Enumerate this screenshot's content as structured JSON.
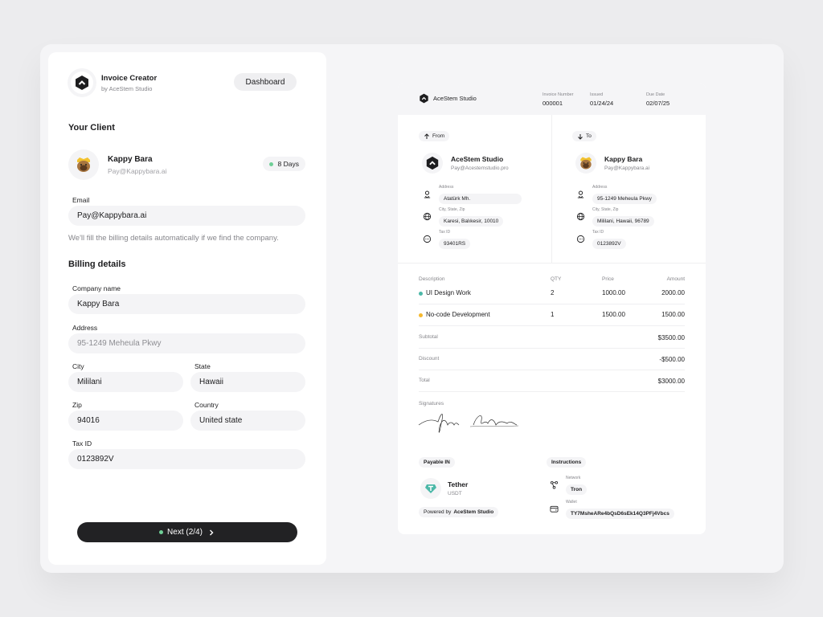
{
  "app": {
    "title": "Invoice Creator",
    "subtitle": "by AceStem Studio",
    "dashboard_label": "Dashboard"
  },
  "client": {
    "section_title": "Your Client",
    "name": "Kappy Bara",
    "email": "Pay@Kappybara.ai",
    "days_badge": "8 Days",
    "days_color": "#6fcf97"
  },
  "form": {
    "email_label": "Email",
    "email_value": "Pay@Kappybara.ai",
    "hint": "We'll fill the billing details automatically if we find the company.",
    "billing_title": "Billing details",
    "company_label": "Company name",
    "company_value": "Kappy Bara",
    "address_label": "Address",
    "address_placeholder": "95-1249 Meheula Pkwy",
    "city_label": "City",
    "city_value": "Mililani",
    "state_label": "State",
    "state_value": "Hawaii",
    "zip_label": "Zip",
    "zip_value": "94016",
    "country_label": "Country",
    "country_value": "United state",
    "tax_label": "Tax ID",
    "tax_value": "0123892V",
    "next_label": "Next (2/4)"
  },
  "invoice": {
    "brand": "AceStem Studio",
    "number_label": "Invoice Number",
    "number": "000001",
    "issued_label": "Issued",
    "issued": "01/24/24",
    "due_label": "Due Date",
    "due": "02/07/25",
    "from": {
      "tag": "From",
      "name": "AceStem Studio",
      "email": "Pay@Acestemstudio.pro",
      "address_label": "Address",
      "address": "Atatürk Mh.",
      "city_label": "City, State, Zip",
      "city": "Karesi, Balıkesir, 10010",
      "tax_label": "Tax ID",
      "tax": "93401RS"
    },
    "to": {
      "tag": "To",
      "name": "Kappy Bara",
      "email": "Pay@Kappybara.ai",
      "address_label": "Address",
      "address": "95-1249 Meheula Pkwy",
      "city_label": "City, State, Zip",
      "city": "Mililani, Hawaii, 96789",
      "tax_label": "Tax ID",
      "tax": "0123892V"
    },
    "table": {
      "headers": [
        "Description",
        "QTY",
        "Price",
        "Amount"
      ],
      "rows": [
        {
          "description": "UI Design Work",
          "qty": "2",
          "price": "1000.00",
          "amount": "2000.00",
          "color": "#4cb8a8"
        },
        {
          "description": "No-code Development",
          "qty": "1",
          "price": "1500.00",
          "amount": "1500.00",
          "color": "#f5b82e"
        }
      ]
    },
    "totals": {
      "subtotal_label": "Subtotal",
      "subtotal": "$3500.00",
      "discount_label": "Discount",
      "discount": "-$500.00",
      "total_label": "Total",
      "total": "$3000.00"
    },
    "signatures_label": "Signatures",
    "payable_label": "Payable IN",
    "currency": "Tether",
    "currency_code": "USDT",
    "powered_prefix": "Powered by",
    "powered_brand": "AceStem Studio",
    "instructions_label": "Instructions",
    "network_label": "Network",
    "network": "Tron",
    "wallet_label": "Wallet",
    "wallet": "TY7MsheARe4bQsD6sEk14Q3PFj4Vbcs"
  }
}
